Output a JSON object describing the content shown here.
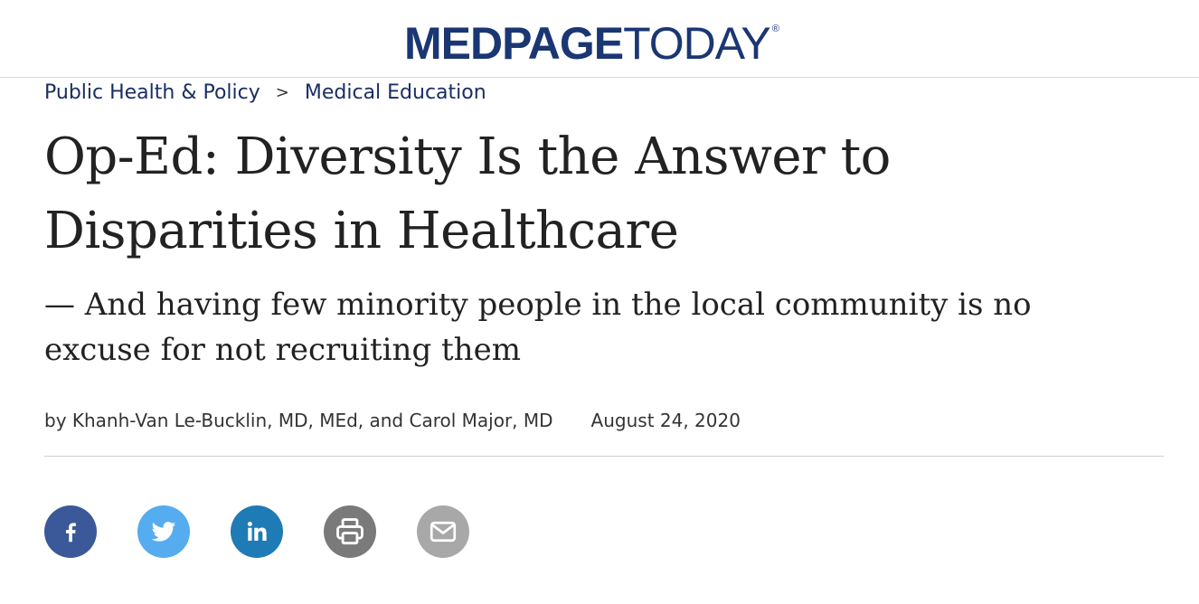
{
  "header": {
    "logo_bold": "MEDPAGE",
    "logo_light": "TODAY",
    "logo_registered": "®"
  },
  "breadcrumb": {
    "items": [
      "Public Health & Policy",
      "Medical Education"
    ],
    "separator": ">"
  },
  "article": {
    "title": "Op-Ed: Diversity Is the Answer to Disparities in Healthcare",
    "subtitle": "— And having few minority people in the local community is no excuse for not recruiting them",
    "byline": "by Khanh-Van Le-Bucklin, MD, MEd, and Carol Major, MD",
    "date": "August 24, 2020"
  },
  "share": {
    "icons": [
      "facebook-icon",
      "twitter-icon",
      "linkedin-icon",
      "print-icon",
      "email-icon"
    ]
  },
  "colors": {
    "brand": "#1a3673",
    "facebook": "#3b5998",
    "twitter": "#55acee",
    "linkedin": "#1f7bb6",
    "print": "#7a7a7a",
    "email": "#a8a8a8"
  }
}
